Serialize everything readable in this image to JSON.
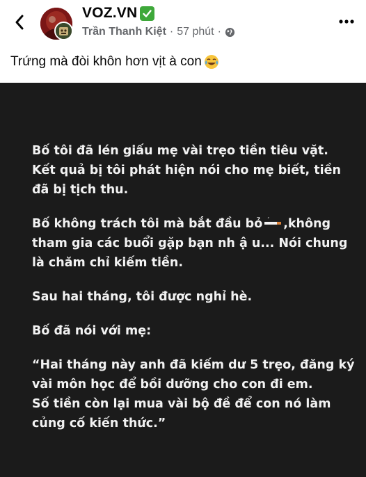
{
  "header": {
    "back_icon": "chevron-left-icon",
    "page_name": "VOZ.VN",
    "verified_icon": "check-mark-button-icon",
    "author": "Trần Thanh Kiệt",
    "time": "57 phút",
    "privacy_icon": "globe-icon",
    "more_icon": "more-horizontal-icon"
  },
  "post": {
    "caption": "Trứng mà đòi khôn hơn vịt à con",
    "caption_emoji": "face-with-tears-of-joy-icon",
    "image_paragraphs": [
      "Bố tôi đã lén giấu mẹ vài trẹo tiền tiêu vặt.\nKết quả bị tôi phát hiện nói cho mẹ biết, tiền\nđã bị tịch thu.",
      "Sau hai tháng, tôi được nghỉ hè.",
      "Bố đã nói với mẹ:",
      "“Hai tháng này anh đã kiếm dư 5 trẹo, đăng ký\nvài môn học để bồi dưỡng cho con đi em.\nSố tiền còn lại mua vài bộ đề để con nó làm\ncủng cố kiến thức.”"
    ],
    "para2_before": "Bố không trách tôi mà bắt đầu bỏ",
    "para2_icon": "cigarette-icon",
    "para2_after": ",không\ntham gia các buổi gặp bạn nh ậ u... Nói chung\nlà chăm chỉ kiếm tiền."
  }
}
